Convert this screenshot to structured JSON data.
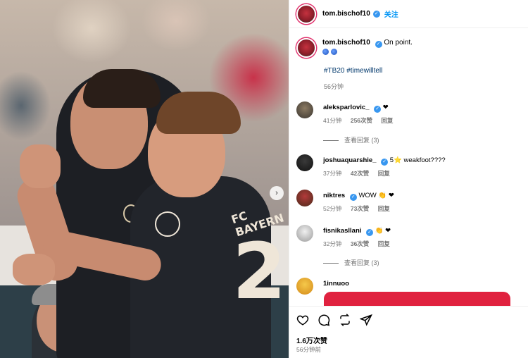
{
  "post": {
    "author": "tom.bischof10",
    "follow_label": "关注",
    "caption_text": "On point.",
    "hashtags": "#TB20 #timewilltell",
    "caption_time": "56分钟",
    "likes": "1.6万次赞",
    "time_ago": "56分钟前",
    "photo": {
      "jersey_brand": "FC BAYERN",
      "jersey_number": "2"
    }
  },
  "comments": [
    {
      "user": "aleksparlovic_",
      "verified": true,
      "text": "❤",
      "time": "41分钟",
      "likes": "256次赞",
      "reply": "回复"
    },
    {
      "user": "joshuaquarshie_",
      "verified": true,
      "text": "5⭐ weakfoot????",
      "time": "37分钟",
      "likes": "42次赞",
      "reply": "回复"
    },
    {
      "user": "niktres",
      "verified": true,
      "text": "WOW 👏 ❤",
      "time": "52分钟",
      "likes": "73次赞",
      "reply": "回复"
    },
    {
      "user": "fisnikasllani",
      "verified": true,
      "text": "👏 ❤",
      "time": "32分钟",
      "likes": "36次赞",
      "reply": "回复"
    },
    {
      "user": "1innuoo",
      "verified": false,
      "text": "",
      "time": "",
      "likes": "",
      "reply": ""
    }
  ],
  "view_replies": [
    "查看回复 (3)",
    "查看回复 (3)"
  ],
  "colors": {
    "accent": "#0095f6",
    "verified": "#3897f0",
    "muted": "#737373",
    "reel_red": "#e0223f"
  },
  "icons": [
    "heart-icon",
    "comment-icon",
    "repost-icon",
    "share-icon",
    "chevron-right-icon",
    "verified-icon"
  ]
}
